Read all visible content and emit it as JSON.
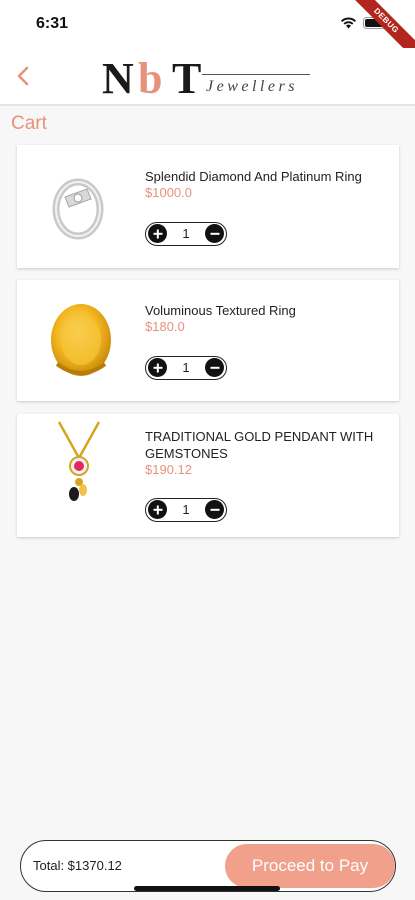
{
  "status_bar": {
    "time": "6:31",
    "debug_label": "DEBUG"
  },
  "header": {
    "logo_letters": {
      "n": "N",
      "b": "b",
      "t": "T"
    },
    "logo_subtitle": "Jewellers"
  },
  "cart": {
    "title": "Cart",
    "items": [
      {
        "name": "Splendid Diamond And Platinum Ring",
        "price": "$1000.0",
        "quantity": "1",
        "image_icon": "silver-diamond-ring"
      },
      {
        "name": "Voluminous Textured Ring",
        "price": "$180.0",
        "quantity": "1",
        "image_icon": "gold-textured-ring"
      },
      {
        "name": "TRADITIONAL GOLD PENDANT WITH GEMSTONES",
        "price": "$190.12",
        "quantity": "1",
        "image_icon": "gold-pendant-necklace"
      }
    ]
  },
  "footer": {
    "total": "Total: $1370.12",
    "pay_label": "Proceed to Pay"
  },
  "colors": {
    "accent": "#e8927c",
    "pay_button": "#f0a08b"
  }
}
